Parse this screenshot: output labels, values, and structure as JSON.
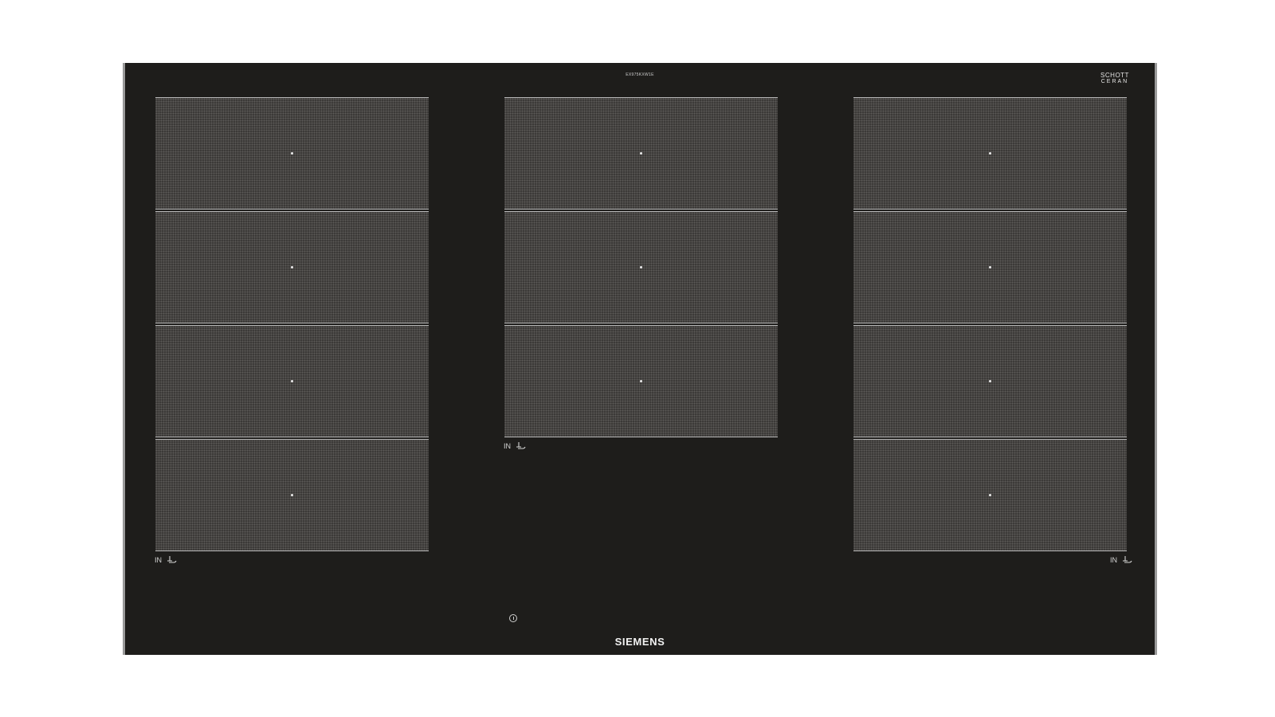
{
  "hob": {
    "model_code": "EX975KXW1E",
    "glass_brand_line1": "SCHOTT",
    "glass_brand_line2": "CERAN",
    "glass_brand_line3": "",
    "brand_logo": "SIEMENS",
    "colors": {
      "glass": "#1e1d1b",
      "zone_fill": "#3c3a38",
      "frame": "#9a9a9a",
      "text": "#f2f2f2"
    }
  },
  "zones": {
    "left": {
      "count": 4,
      "label": "IN"
    },
    "center": {
      "count": 3,
      "label": "IN"
    },
    "right": {
      "count": 4,
      "label": "IN"
    }
  },
  "icons": {
    "induction": "induction-symbol-icon",
    "power": "power-button-icon"
  }
}
